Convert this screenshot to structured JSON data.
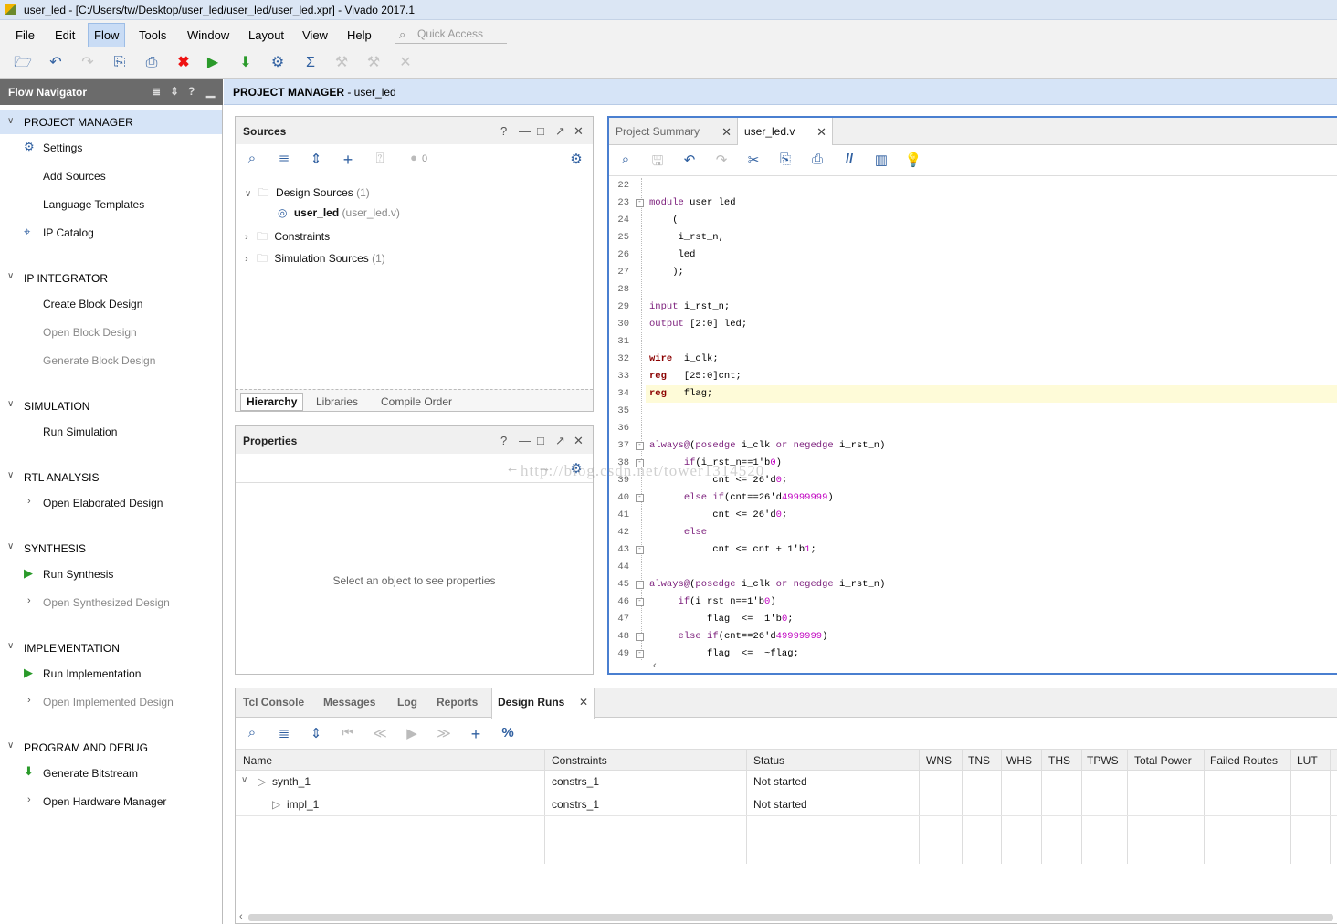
{
  "window": {
    "title": "user_led - [C:/Users/tw/Desktop/user_led/user_led/user_led.xpr] - Vivado 2017.1"
  },
  "menu": [
    "File",
    "Edit",
    "Flow",
    "Tools",
    "Window",
    "Layout",
    "View",
    "Help"
  ],
  "quick_access": {
    "placeholder": "Quick Access"
  },
  "flow_navigator": {
    "title": "Flow Navigator",
    "sections": {
      "project_manager": {
        "label": "PROJECT MANAGER",
        "items": [
          "Settings",
          "Add Sources",
          "Language Templates",
          "IP Catalog"
        ]
      },
      "ip_integrator": {
        "label": "IP INTEGRATOR",
        "items": [
          "Create Block Design",
          "Open Block Design",
          "Generate Block Design"
        ]
      },
      "simulation": {
        "label": "SIMULATION",
        "items": [
          "Run Simulation"
        ]
      },
      "rtl_analysis": {
        "label": "RTL ANALYSIS",
        "items": [
          "Open Elaborated Design"
        ]
      },
      "synthesis": {
        "label": "SYNTHESIS",
        "items": [
          "Run Synthesis",
          "Open Synthesized Design"
        ]
      },
      "implementation": {
        "label": "IMPLEMENTATION",
        "items": [
          "Run Implementation",
          "Open Implemented Design"
        ]
      },
      "program_debug": {
        "label": "PROGRAM AND DEBUG",
        "items": [
          "Generate Bitstream",
          "Open Hardware Manager"
        ]
      }
    }
  },
  "pm_header": {
    "prefix": "PROJECT MANAGER",
    "project": " - user_led"
  },
  "sources": {
    "title": "Sources",
    "count": "0",
    "tree": {
      "design_sources": "Design Sources",
      "design_sources_count": "(1)",
      "user_led": "user_led",
      "user_led_file": "(user_led.v)",
      "constraints": "Constraints",
      "simulation_sources": "Simulation Sources",
      "simulation_sources_count": "(1)"
    },
    "tabs": [
      "Hierarchy",
      "Libraries",
      "Compile Order"
    ]
  },
  "properties": {
    "title": "Properties",
    "empty_text": "Select an object to see properties"
  },
  "editor": {
    "tabs": [
      "Project Summary",
      "user_led.v"
    ],
    "lines": [
      {
        "n": "22",
        "t": ""
      },
      {
        "n": "23",
        "t": "module user_led"
      },
      {
        "n": "24",
        "t": "    ("
      },
      {
        "n": "25",
        "t": "     i_rst_n,"
      },
      {
        "n": "26",
        "t": "     led"
      },
      {
        "n": "27",
        "t": "    );"
      },
      {
        "n": "28",
        "t": ""
      },
      {
        "n": "29",
        "t": "input i_rst_n;"
      },
      {
        "n": "30",
        "t": "output [2:0] led;"
      },
      {
        "n": "31",
        "t": ""
      },
      {
        "n": "32",
        "t": "wire  i_clk;"
      },
      {
        "n": "33",
        "t": "reg   [25:0]cnt;"
      },
      {
        "n": "34",
        "t": "reg   flag;"
      },
      {
        "n": "35",
        "t": ""
      },
      {
        "n": "36",
        "t": ""
      },
      {
        "n": "37",
        "t": "always@(posedge i_clk or negedge i_rst_n)"
      },
      {
        "n": "38",
        "t": "      if(i_rst_n==1'b0)"
      },
      {
        "n": "39",
        "t": "           cnt <= 26'd0;"
      },
      {
        "n": "40",
        "t": "      else if(cnt==26'd49999999)"
      },
      {
        "n": "41",
        "t": "           cnt <= 26'd0;"
      },
      {
        "n": "42",
        "t": "      else"
      },
      {
        "n": "43",
        "t": "           cnt <= cnt + 1'b1;"
      },
      {
        "n": "44",
        "t": ""
      },
      {
        "n": "45",
        "t": "always@(posedge i_clk or negedge i_rst_n)"
      },
      {
        "n": "46",
        "t": "     if(i_rst_n==1'b0)"
      },
      {
        "n": "47",
        "t": "          flag  <=  1'b0;"
      },
      {
        "n": "48",
        "t": "     else if(cnt==26'd49999999)"
      },
      {
        "n": "49",
        "t": "          flag  <=  ~flag;"
      }
    ]
  },
  "watermark": "http://blog.csdn.net/tower1314520",
  "bottom": {
    "tabs": [
      "Tcl Console",
      "Messages",
      "Log",
      "Reports",
      "Design Runs"
    ],
    "columns": [
      "Name",
      "Constraints",
      "Status",
      "WNS",
      "TNS",
      "WHS",
      "THS",
      "TPWS",
      "Total Power",
      "Failed Routes",
      "LUT"
    ],
    "rows": [
      {
        "name": "synth_1",
        "constraints": "constrs_1",
        "status": "Not started"
      },
      {
        "name": "impl_1",
        "constraints": "constrs_1",
        "status": "Not started"
      }
    ]
  }
}
